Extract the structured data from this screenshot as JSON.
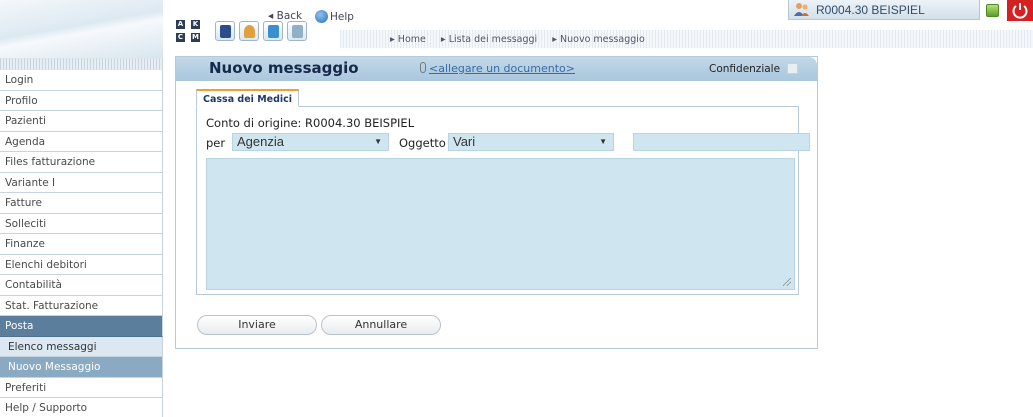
{
  "toolbar": {
    "abbrev": [
      "A",
      "K",
      "C",
      "M"
    ],
    "back_label": "Back",
    "help_label": "Help"
  },
  "breadcrumb": [
    "Home",
    "Lista dei messaggi",
    "Nuovo messaggio"
  ],
  "user": {
    "name": "R0004.30 BEISPIEL"
  },
  "sidebar": {
    "items": [
      {
        "label": "Login"
      },
      {
        "label": "Profilo"
      },
      {
        "label": "Pazienti"
      },
      {
        "label": "Agenda"
      },
      {
        "label": "Files fatturazione"
      },
      {
        "label": "Variante I"
      },
      {
        "label": "Fatture"
      },
      {
        "label": "Solleciti"
      },
      {
        "label": "Finanze"
      },
      {
        "label": "Elenchi debitori"
      },
      {
        "label": "Contabilità"
      },
      {
        "label": "Stat. Fatturazione"
      },
      {
        "label": "Posta"
      },
      {
        "label": "Elenco messaggi"
      },
      {
        "label": "Nuovo Messaggio"
      },
      {
        "label": "Preferiti"
      },
      {
        "label": "Help / Supporto"
      }
    ]
  },
  "panel": {
    "title": "Nuovo messaggio",
    "attach_label": "<allegare un documento>",
    "confidential_label": "Confidenziale",
    "tab_label": "Cassa dei Medici",
    "origin_label": "Conto di origine: R0004.30 BEISPIEL",
    "per_label": "per",
    "per_value": "Agenzia",
    "subject_label": "Oggetto",
    "subject_value": "Vari",
    "send_label": "Inviare",
    "cancel_label": "Annullare"
  },
  "colors": {
    "header": "#a9c7dd",
    "field": "#cfe6f0",
    "section": "#5b7e9c",
    "power": "#d42020"
  }
}
